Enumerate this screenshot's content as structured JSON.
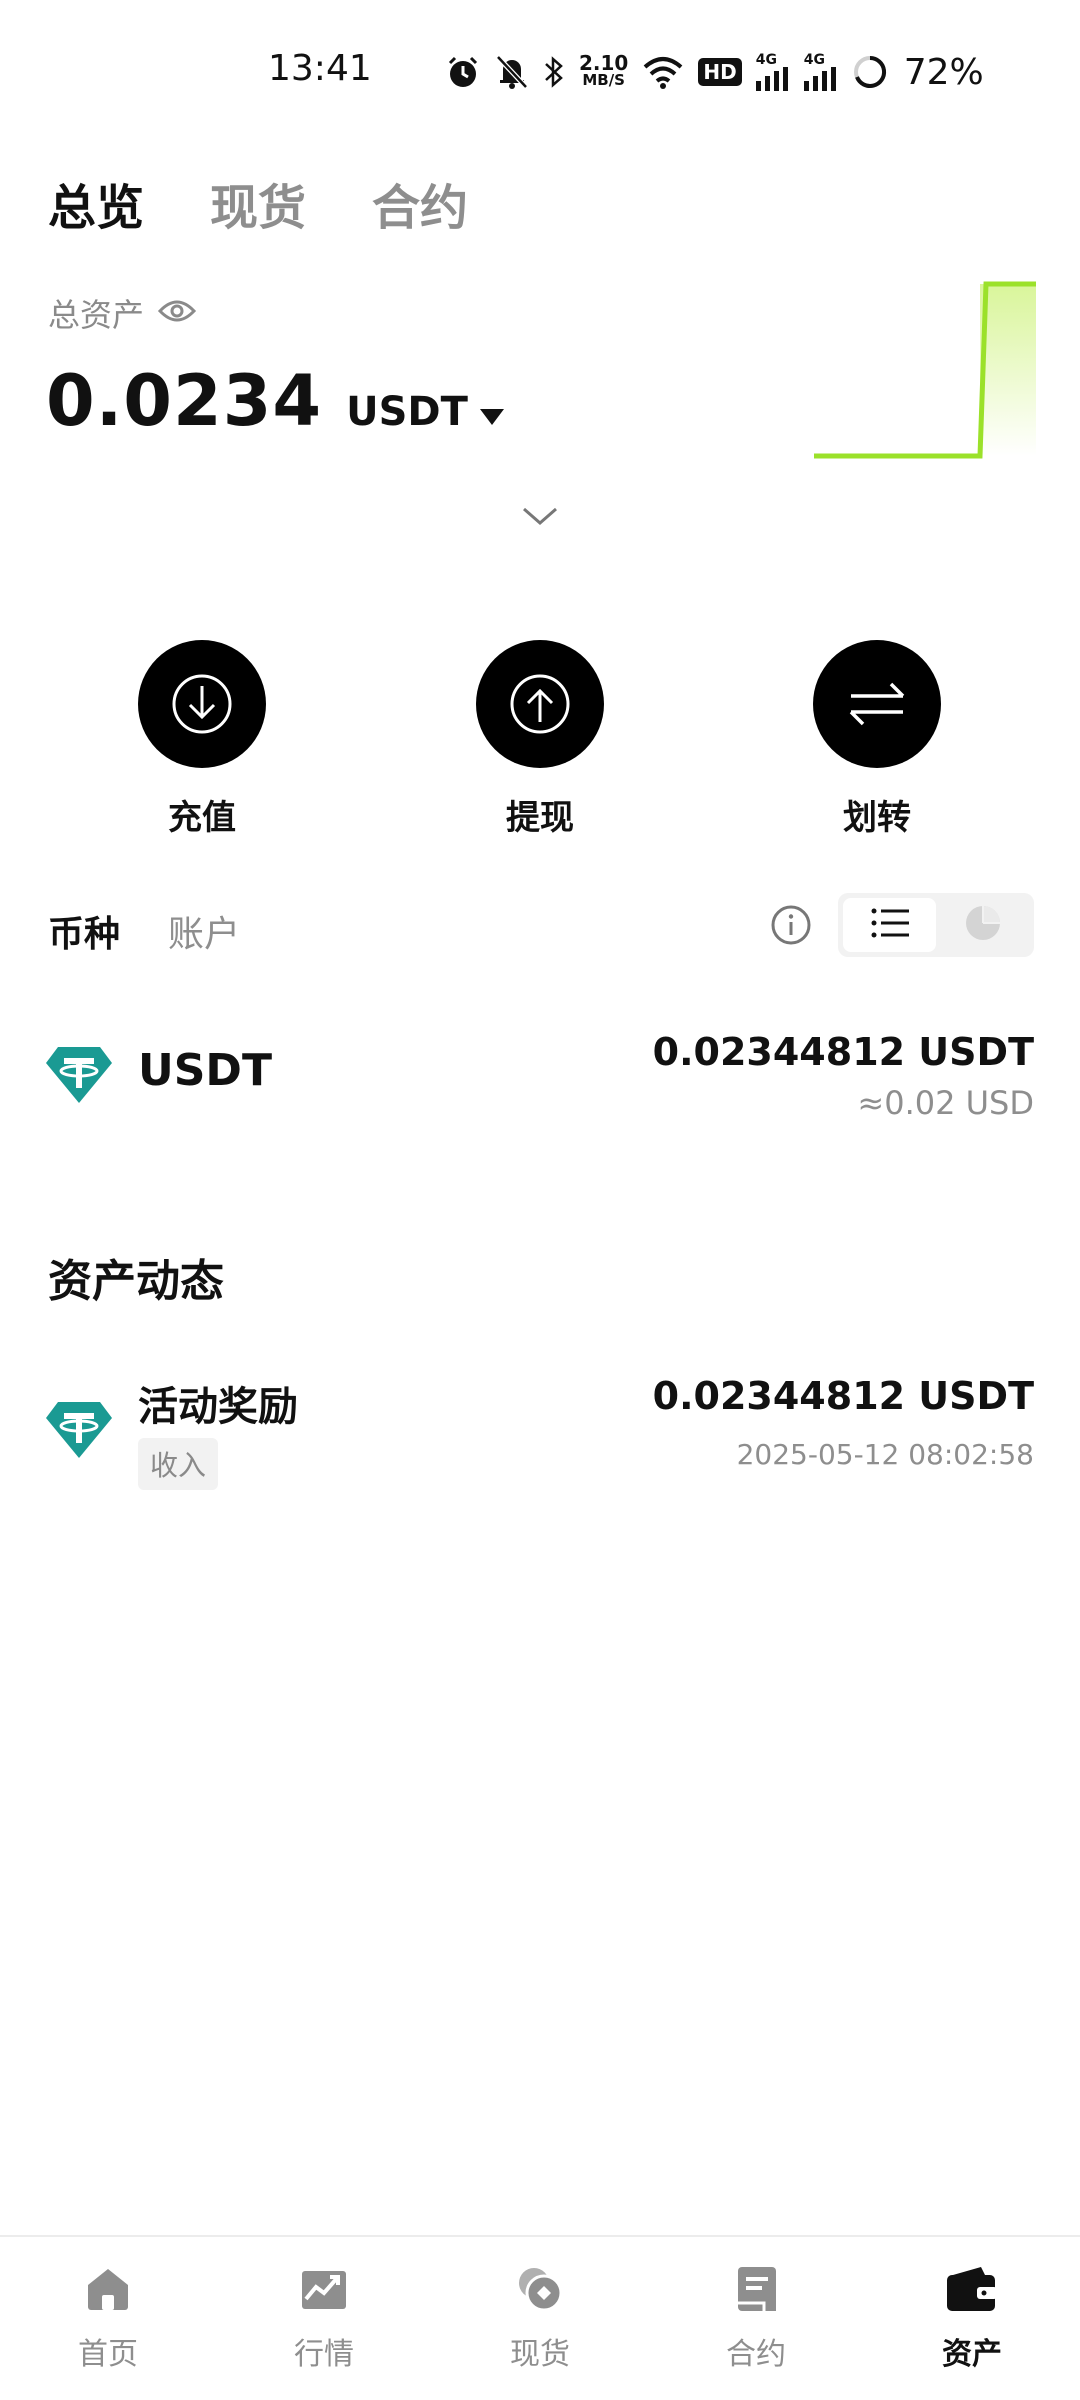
{
  "status_bar": {
    "time": "13:41",
    "speed_value": "2.10",
    "speed_unit": "MB/S",
    "hd_label": "HD",
    "net1": "4G",
    "net2": "4G",
    "battery": "72%",
    "icons": [
      "alarm-icon",
      "mute-bell-icon",
      "bluetooth-icon",
      "wifi-icon",
      "hd-icon",
      "signal-icon",
      "signal-icon",
      "battery-ring-icon"
    ]
  },
  "top_tabs": [
    {
      "label": "总览",
      "active": true
    },
    {
      "label": "现货",
      "active": false
    },
    {
      "label": "合约",
      "active": false
    }
  ],
  "total_assets": {
    "label": "总资产",
    "value": "0.0234",
    "currency": "USDT"
  },
  "actions": [
    {
      "label": "充值",
      "icon": "deposit-icon"
    },
    {
      "label": "提现",
      "icon": "withdraw-icon"
    },
    {
      "label": "划转",
      "icon": "transfer-icon"
    }
  ],
  "holding_tabs": [
    {
      "label": "币种",
      "active": true
    },
    {
      "label": "账户",
      "active": false
    }
  ],
  "holdings": [
    {
      "coin": "USDT",
      "amount": "0.02344812 USDT",
      "usd_value": "≈0.02 USD",
      "icon": "tether-icon"
    }
  ],
  "activity": {
    "title": "资产动态",
    "items": [
      {
        "title": "活动奖励",
        "tag": "收入",
        "amount": "0.02344812 USDT",
        "time": "2025-05-12 08:02:58",
        "icon": "tether-icon"
      }
    ]
  },
  "bottom_nav": [
    {
      "label": "首页",
      "icon": "home-icon",
      "active": false
    },
    {
      "label": "行情",
      "icon": "market-icon",
      "active": false
    },
    {
      "label": "现货",
      "icon": "spot-icon",
      "active": false
    },
    {
      "label": "合约",
      "icon": "contract-icon",
      "active": false
    },
    {
      "label": "资产",
      "icon": "wallet-icon",
      "active": true
    }
  ],
  "colors": {
    "accent_green": "#9be12a",
    "tether_teal": "#1a9a93",
    "text_primary": "#111111",
    "text_secondary": "#8e8e8e"
  }
}
